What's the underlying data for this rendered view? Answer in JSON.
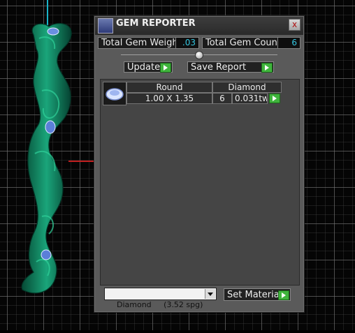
{
  "window": {
    "title": "GEM REPORTER",
    "close_label": "x"
  },
  "summary": {
    "total_weight_label": "Total Gem Weight",
    "total_weight_value": ".03",
    "total_count_label": "Total Gem Count",
    "total_count_value": "6"
  },
  "actions": {
    "update_label": "Update",
    "save_report_label": "Save Report"
  },
  "gem_list": {
    "rows": [
      {
        "shape": "Round",
        "material": "Diamond",
        "size": "1.00 X 1.35",
        "count": "6",
        "weight": "0.031tw"
      }
    ]
  },
  "material": {
    "selected": "Diamond     (3.52 spg)",
    "set_material_label": "Set Material"
  },
  "colors": {
    "panel_bg": "#5a5a5a",
    "value_text": "#35c6e0",
    "go_button": "#3fb43c",
    "model": "#0f7a5a"
  },
  "icons": {
    "app": "gem-reporter-app-icon",
    "close": "close-icon",
    "go": "play-arrow-icon",
    "thumb": "round-gem-icon",
    "dropdown": "chevron-down-icon"
  }
}
